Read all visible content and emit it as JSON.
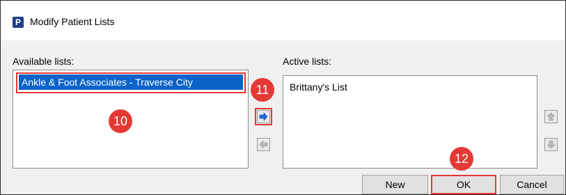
{
  "window": {
    "title": "Modify Patient Lists",
    "app_icon_letter": "P"
  },
  "available": {
    "label": "Available lists:",
    "items": [
      "Ankle & Foot Associates - Traverse City"
    ]
  },
  "active": {
    "label": "Active lists:",
    "items": [
      "Brittany's List"
    ]
  },
  "buttons": {
    "new": "New",
    "ok": "OK",
    "cancel": "Cancel"
  },
  "callouts": [
    "10",
    "11",
    "12"
  ],
  "colors": {
    "selection": "#0a63c9",
    "callout": "#e53935",
    "arrow_blue": "#1e6ad8"
  }
}
